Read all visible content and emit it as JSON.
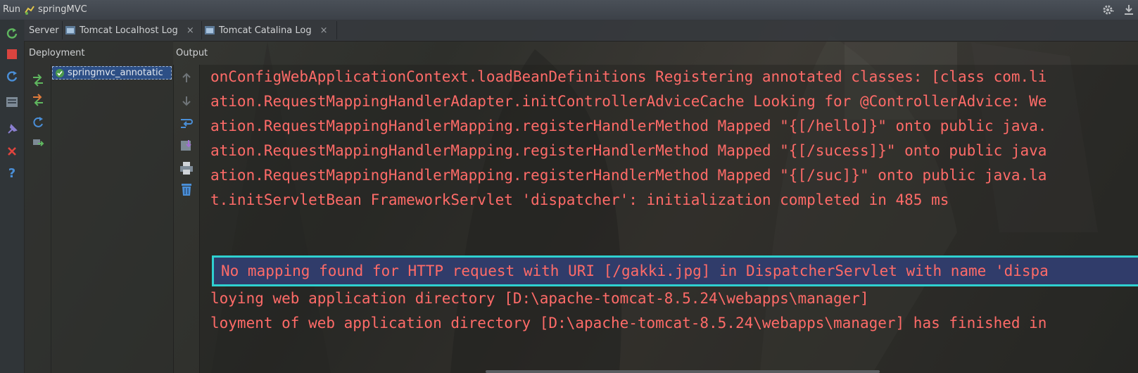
{
  "window": {
    "run_label": "Run",
    "project_name": "springMVC"
  },
  "tabs": [
    {
      "label": "Server",
      "closable": false
    },
    {
      "label": "Tomcat Localhost Log",
      "closable": true
    },
    {
      "label": "Tomcat Catalina Log",
      "closable": true
    }
  ],
  "tab_close_glyph": "×",
  "deployment": {
    "title": "Deployment",
    "item": "springmvc_annotatic"
  },
  "output": {
    "title": "Output",
    "lines": [
      "onConfigWebApplicationContext.loadBeanDefinitions Registering annotated classes: [class com.li",
      "ation.RequestMappingHandlerAdapter.initControllerAdviceCache Looking for @ControllerAdvice: We",
      "ation.RequestMappingHandlerMapping.registerHandlerMethod Mapped \"{[/hello]}\" onto public java.",
      "ation.RequestMappingHandlerMapping.registerHandlerMethod Mapped \"{[/sucess]}\" onto public java",
      "ation.RequestMappingHandlerMapping.registerHandlerMethod Mapped \"{[/suc]}\" onto public java.la",
      "t.initServletBean FrameworkServlet 'dispatcher': initialization completed in 485 ms"
    ],
    "highlighted_line": "No mapping found for HTTP request with URI [/gakki.jpg] in DispatcherServlet with name 'dispa",
    "after_lines": [
      "loying web application directory [D:\\apache-tomcat-8.5.24\\webapps\\manager]",
      "loyment of web application directory [D:\\apache-tomcat-8.5.24\\webapps\\manager] has finished in"
    ]
  },
  "icons": {
    "left_strip": [
      "rerun-icon",
      "stop-icon",
      "update-icon",
      "dump-threads-icon",
      "pin-icon",
      "close-icon",
      "help-icon"
    ],
    "deployment_tools": [
      "deploy-icon",
      "undeploy-icon",
      "redeploy-icon",
      "artifact-icon"
    ],
    "output_tools": [
      "scroll-up-icon",
      "scroll-down-icon",
      "soft-wrap-icon",
      "scroll-to-end-icon",
      "print-icon",
      "clear-all-icon"
    ]
  },
  "colors": {
    "console_text": "#ff6b68",
    "highlight_border": "#2fd0d0",
    "selection_bg": "#2d4f86"
  }
}
